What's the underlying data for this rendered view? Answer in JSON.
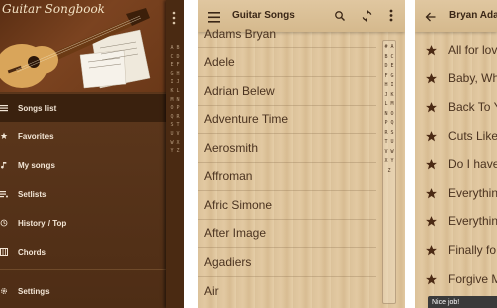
{
  "drawer": {
    "app_name": "Guitar Songbook",
    "items": [
      {
        "label": "Songs list",
        "icon": "list-icon",
        "active": true
      },
      {
        "label": "Favorites",
        "icon": "star-icon",
        "active": false
      },
      {
        "label": "My songs",
        "icon": "music-note-icon",
        "active": false
      },
      {
        "label": "Setlists",
        "icon": "playlist-icon",
        "active": false
      },
      {
        "label": "History / Top",
        "icon": "history-icon",
        "active": false
      },
      {
        "label": "Chords",
        "icon": "chord-icon",
        "active": false
      },
      {
        "label": "Settings",
        "icon": "gear-icon",
        "active": false
      }
    ],
    "index_letters": "A B C D E F G H I J K L M N O P Q R S T U V W X Y Z"
  },
  "songs_screen": {
    "title": "Guitar Songs",
    "artists": [
      "Adams Bryan",
      "Adele",
      "Adrian Belew",
      "Adventure Time",
      "Aerosmith",
      "Affroman",
      "Afric Simone",
      "After Image",
      "Agadiers",
      "Air"
    ],
    "index_letters": "# A B C D E F G H I J K L M N O P Q R S T U V W X Y Z"
  },
  "artist_screen": {
    "title": "Bryan Ada",
    "songs": [
      "All for lov",
      "Baby, Wh",
      "Back To Y",
      "Cuts Like",
      "Do I have",
      "Everythin",
      "Everythin",
      "Finally fo",
      "Forgive M"
    ],
    "toast": "Nice job!"
  },
  "colors": {
    "drawer_bg": "#5a3519",
    "active_item_bg": "#3a210e",
    "wood_light": "#e2c9a2",
    "text_dark": "#4b3320"
  }
}
